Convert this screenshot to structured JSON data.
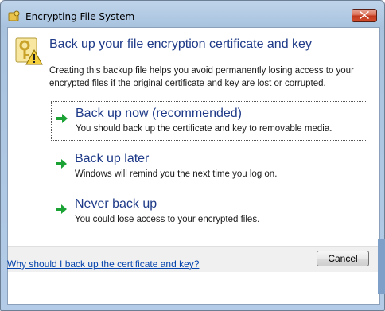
{
  "window": {
    "title": "Encrypting File System",
    "icon": "key-folder-icon",
    "close_icon": "close-icon"
  },
  "header": {
    "icon": "certificate-key-warning-icon",
    "title": "Back up your file encryption certificate and key",
    "intro": "Creating this backup file helps you avoid permanently losing access to your encrypted files if the original certificate and key are lost or corrupted."
  },
  "options": [
    {
      "title": "Back up now (recommended)",
      "description": "You should back up the certificate and key to removable media.",
      "icon": "green-arrow-icon",
      "focused": true
    },
    {
      "title": "Back up later",
      "description": "Windows will remind you the next time you log on.",
      "icon": "green-arrow-icon",
      "focused": false
    },
    {
      "title": "Never back up",
      "description": "You could lose access to your encrypted files.",
      "icon": "green-arrow-icon",
      "focused": false
    }
  ],
  "footer": {
    "cancel_label": "Cancel",
    "help_link": "Why should I back up the certificate and key?"
  },
  "colors": {
    "accent_text": "#1e3a88",
    "link": "#0645ad",
    "arrow": "#1aa334",
    "close": "#c0381d"
  }
}
